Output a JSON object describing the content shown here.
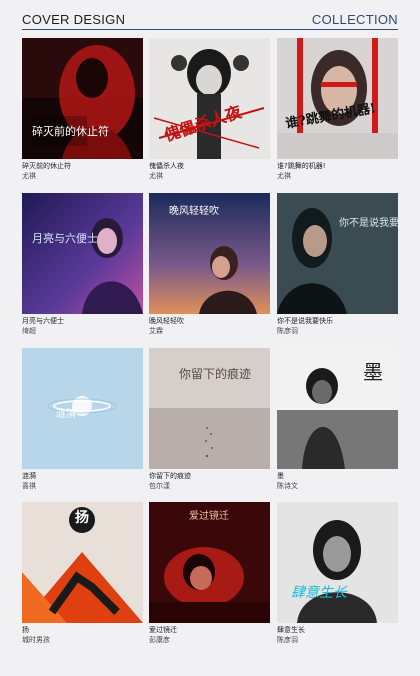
{
  "header": {
    "title": "COVER DESIGN",
    "collection": "COLLECTION"
  },
  "albums": [
    {
      "song": "碎灭前的休止符",
      "artist": "尤祺",
      "cover_text": "碎灭前的休止符",
      "palette": [
        "#1a0808",
        "#b01616",
        "#e03a3a"
      ]
    },
    {
      "song": "傀儡杀人夜",
      "artist": "尤祺",
      "cover_text": "傀儡杀人夜",
      "palette": [
        "#e8e6e4",
        "#888888",
        "#c21212"
      ]
    },
    {
      "song": "谁?跳舞的机器!",
      "artist": "尤祺",
      "cover_text": "谁?跳舞的机器!",
      "palette": [
        "#d8d4d4",
        "#d01a1a",
        "#222222"
      ]
    },
    {
      "song": "月亮与六便士",
      "artist": "绮超",
      "cover_text": "月亮与六便士",
      "palette": [
        "#201a55",
        "#5a3a9a",
        "#c050a0"
      ]
    },
    {
      "song": "晚风轻轻吹",
      "artist": "艾霖",
      "cover_text": "晚风轻轻吹",
      "palette": [
        "#1c2a5c",
        "#7a5a8a",
        "#e0905a"
      ]
    },
    {
      "song": "你不是说我要快乐",
      "artist": "陈彦羽",
      "cover_text": "你不是说我要快乐",
      "palette": [
        "#2a3a40",
        "#4a5e64",
        "#9aacae"
      ]
    },
    {
      "song": "涟漪",
      "artist": "喜祺",
      "cover_text": "涟漪",
      "palette": [
        "#b8d6ea",
        "#9cc4e0",
        "#ffffff"
      ]
    },
    {
      "song": "你留下的痕迹",
      "artist": "包尔漾",
      "cover_text": "你留下的痕迹",
      "palette": [
        "#d6cecb",
        "#b8aeaa",
        "#5a4a46"
      ]
    },
    {
      "song": "墨",
      "artist": "陈诗文",
      "cover_text": "墨",
      "palette": [
        "#f2f2f2",
        "#777777",
        "#1a1a1a"
      ]
    },
    {
      "song": "扬",
      "artist": "城时男孩",
      "cover_text": "扬",
      "palette": [
        "#e8e0d8",
        "#e04010",
        "#1a1a1a"
      ]
    },
    {
      "song": "爱过镜迁",
      "artist": "彭康彦",
      "cover_text": "爱过镜迁",
      "palette": [
        "#3a0808",
        "#a81a14",
        "#e05a40"
      ]
    },
    {
      "song": "肆意生长",
      "artist": "陈彦羽",
      "cover_text": "肆意生长",
      "palette": [
        "#e4e4e4",
        "#8a8a8a",
        "#1abcd8"
      ]
    }
  ]
}
